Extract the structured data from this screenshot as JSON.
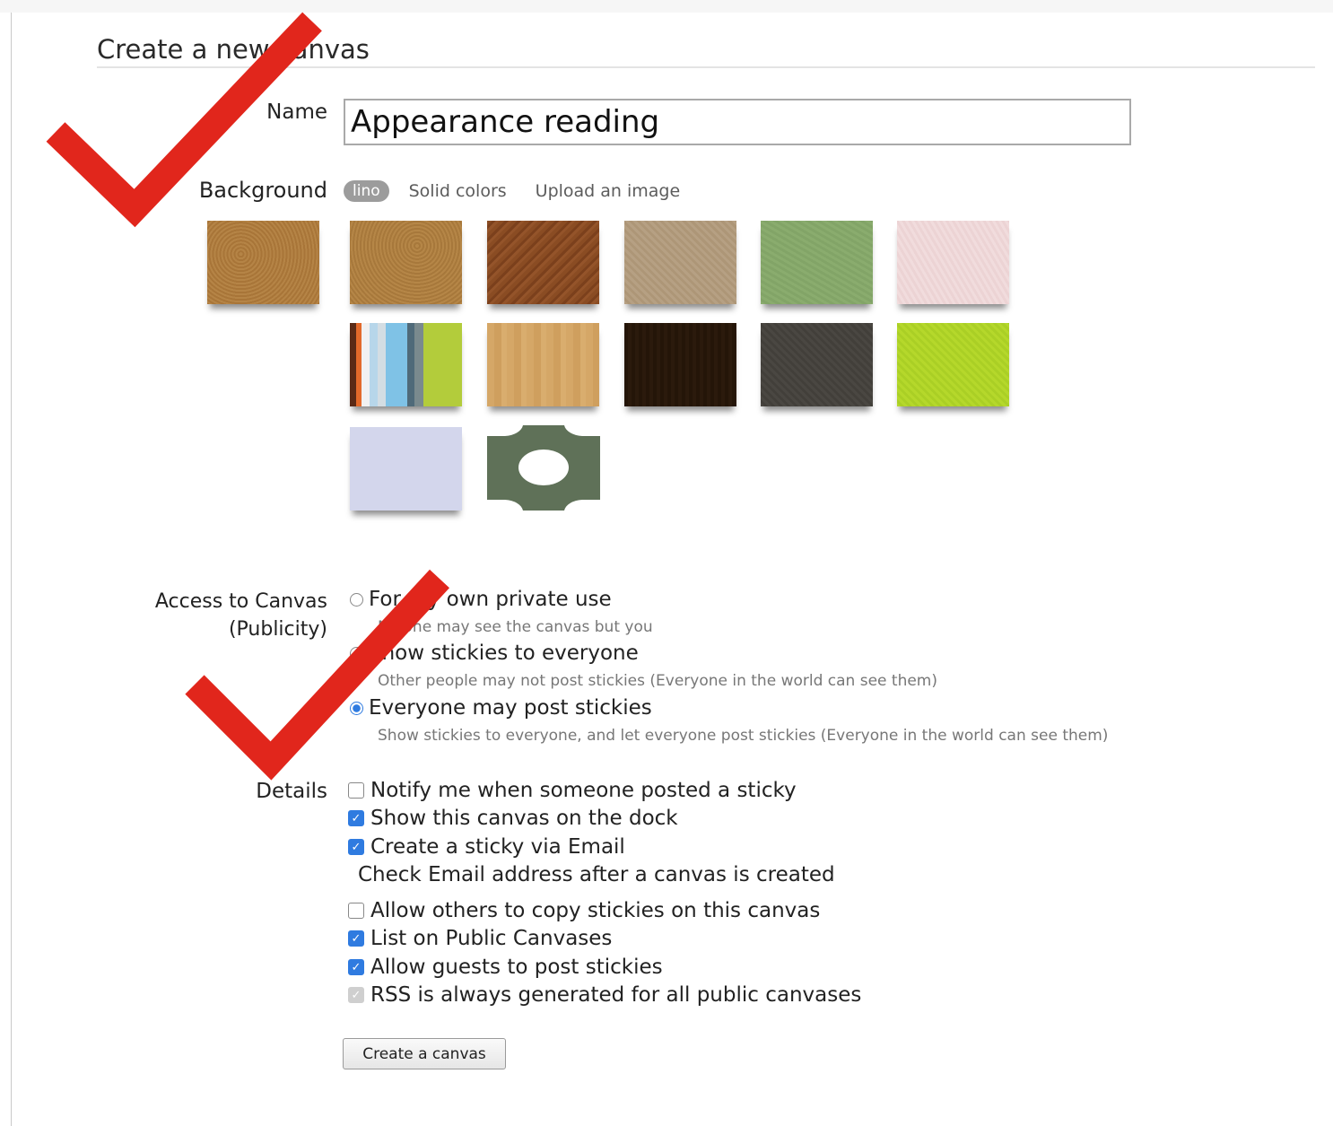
{
  "page": {
    "title": "Create a new canvas"
  },
  "name_field": {
    "label": "Name",
    "value": "Appearance reading"
  },
  "background": {
    "label": "Background",
    "tabs": [
      "lino",
      "Solid colors",
      "Upload an image"
    ],
    "selected_tab": "lino"
  },
  "access": {
    "label_line1": "Access to Canvas",
    "label_line2": "(Publicity)",
    "options": [
      {
        "label": "For my own private use",
        "description": "No one may see the canvas but you",
        "selected": false
      },
      {
        "label": "Show stickies to everyone",
        "description": "Other people may not post stickies (Everyone in the world can see them)",
        "selected": false
      },
      {
        "label": "Everyone may post stickies",
        "description": "Show stickies to everyone, and let everyone post stickies (Everyone in the world can see them)",
        "selected": true
      }
    ]
  },
  "details": {
    "label": "Details",
    "items": [
      {
        "label": "Notify me when someone posted a sticky",
        "checked": false
      },
      {
        "label": "Show this canvas on the dock",
        "checked": true
      },
      {
        "label": "Create a sticky via Email",
        "checked": true
      },
      {
        "label": "Allow others to copy stickies on this canvas",
        "checked": false
      },
      {
        "label": "List on Public Canvases",
        "checked": true
      },
      {
        "label": "Allow guests to post stickies",
        "checked": true
      },
      {
        "label": "RSS is always generated for all public canvases",
        "checked": true,
        "disabled": true
      }
    ],
    "email_note": "Check Email address after a canvas is created"
  },
  "submit": {
    "label": "Create a canvas"
  },
  "colors": {
    "annotation_check": "#e1261c",
    "accent": "#2f7be0"
  }
}
